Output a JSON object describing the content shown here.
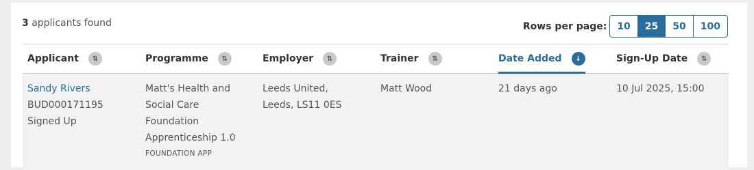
{
  "summary": {
    "count": "3",
    "text": "applicants found"
  },
  "rows_per_page": {
    "label": "Rows per page:",
    "options": [
      "10",
      "25",
      "50",
      "100"
    ],
    "selected": "25"
  },
  "columns": [
    {
      "label": "Applicant",
      "sort_icon": "sort-icon"
    },
    {
      "label": "Programme",
      "sort_icon": "sort-icon"
    },
    {
      "label": "Employer",
      "sort_icon": "sort-icon"
    },
    {
      "label": "Trainer",
      "sort_icon": "sort-icon"
    },
    {
      "label": "Date Added",
      "sort_icon": "sort-desc-icon",
      "active": true
    },
    {
      "label": "Sign-Up Date",
      "sort_icon": "sort-icon"
    }
  ],
  "rows": [
    {
      "applicant_name": "Sandy Rivers",
      "applicant_id": "BUD000171195",
      "applicant_status": "Signed Up",
      "programme_line1": "Matt's Health and",
      "programme_line2": "Social Care",
      "programme_line3": "Foundation",
      "programme_line4": "Apprenticeship 1.0",
      "programme_tag": "FOUNDATION APP",
      "employer_line1": "Leeds United,",
      "employer_line2": "Leeds, LS11 0ES",
      "trainer": "Matt Wood",
      "date_added": "21 days ago",
      "signup_date": "10 Jul 2025, 15:00"
    }
  ],
  "colors": {
    "accent": "#2a6d9c",
    "row_bg": "#f2f2f2"
  }
}
